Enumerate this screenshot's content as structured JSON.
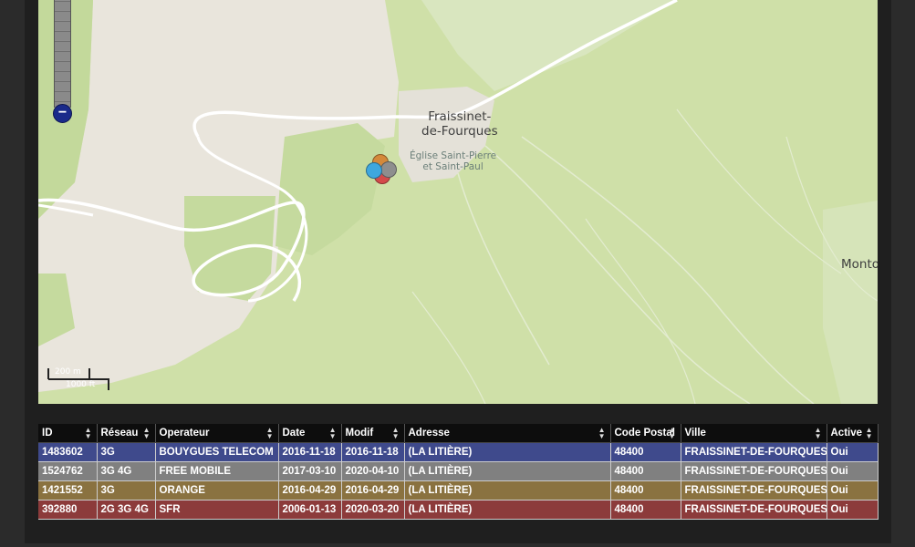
{
  "map": {
    "town_line1": "Fraissinet-",
    "town_line2": "de-Fourques",
    "poi_line1": "Église Saint-Pierre",
    "poi_line2": "et Saint-Paul",
    "edge_label": "Monto",
    "zoom_out_symbol": "−",
    "scale_top": "200 m",
    "scale_bottom": "1000 ft",
    "colors": {
      "forest": "#cfe0a8",
      "open_land": "#e9e5dc",
      "road": "#ffffff",
      "zoom_button": "#1a2a8a"
    },
    "markers": [
      {
        "operator": "ORANGE",
        "color": "#d4893a"
      },
      {
        "operator": "SFR",
        "color": "#d44a4a"
      },
      {
        "operator": "FREE MOBILE",
        "color": "#8e8e8e"
      },
      {
        "operator": "BOUYGUES TELECOM",
        "color": "#3fa7de"
      }
    ]
  },
  "table": {
    "columns": [
      {
        "label": "ID",
        "sort_icon": "sort-icon"
      },
      {
        "label": "Réseau",
        "sort_icon": "sort-icon"
      },
      {
        "label": "Operateur",
        "sort_icon": "sort-icon"
      },
      {
        "label": "Date",
        "sort_icon": "sort-icon"
      },
      {
        "label": "Modif",
        "sort_icon": "sort-icon"
      },
      {
        "label": "Adresse",
        "sort_icon": "sort-icon"
      },
      {
        "label": "Code Postal",
        "sort_icon": "sort-icon"
      },
      {
        "label": "Ville",
        "sort_icon": "sort-icon"
      },
      {
        "label": "Active",
        "sort_icon": "sort-icon"
      }
    ],
    "rows": [
      {
        "color": "#3f4a8c",
        "cells": [
          "1483602",
          "3G",
          "BOUYGUES TELECOM",
          "2016-11-18",
          "2016-11-18",
          "(LA LITIÈRE)",
          "48400",
          "FRAISSINET-DE-FOURQUES",
          "Oui"
        ]
      },
      {
        "color": "#808080",
        "cells": [
          "1524762",
          "3G 4G",
          "FREE MOBILE",
          "2017-03-10",
          "2020-04-10",
          "(LA LITIÈRE)",
          "48400",
          "FRAISSINET-DE-FOURQUES",
          "Oui"
        ]
      },
      {
        "color": "#8a7240",
        "cells": [
          "1421552",
          "3G",
          "ORANGE",
          "2016-04-29",
          "2016-04-29",
          "(LA LITIÈRE)",
          "48400",
          "FRAISSINET-DE-FOURQUES",
          "Oui"
        ]
      },
      {
        "color": "#8c3b3b",
        "cells": [
          "392880",
          "2G 3G 4G",
          "SFR",
          "2006-01-13",
          "2020-03-20",
          "(LA LITIÈRE)",
          "48400",
          "FRAISSINET-DE-FOURQUES",
          "Oui"
        ]
      }
    ]
  }
}
